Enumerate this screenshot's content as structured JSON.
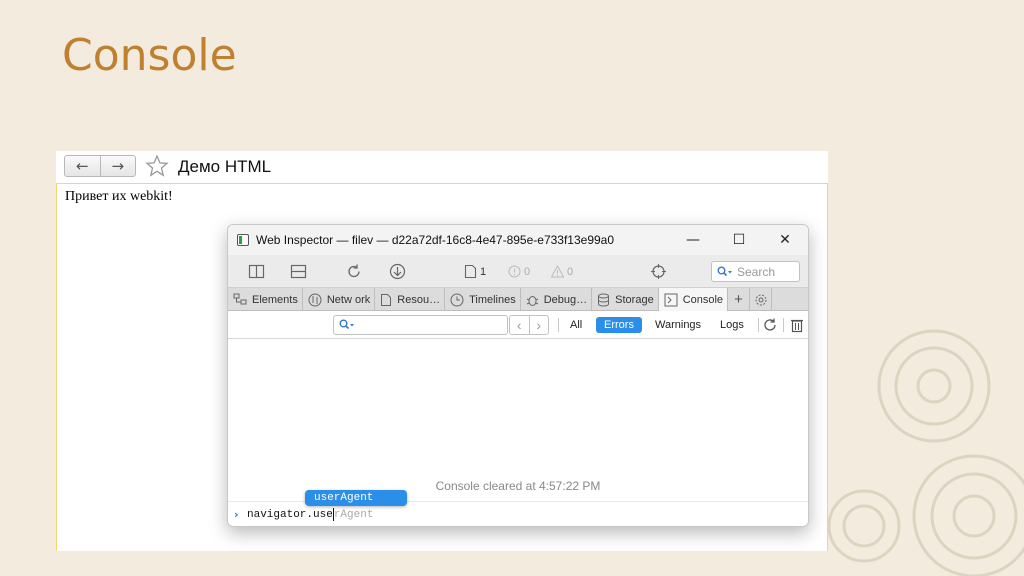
{
  "slide": {
    "title": "Console"
  },
  "browser": {
    "back_label": "←",
    "forward_label": "→",
    "tab_title": "Демо HTML",
    "page_text": "Привет их webkit!"
  },
  "inspector": {
    "window_title": "Web Inspector — filev — d22a72df-16c8-4e47-895e-e733f13e99a0",
    "controls": {
      "minimize": "—",
      "maximize": "☐",
      "close": "✕"
    },
    "toolbar": {
      "resource_count": "1",
      "error_count": "0",
      "warning_count": "0",
      "search_placeholder": "Search"
    },
    "tabs": [
      {
        "label": "Elements",
        "icon": "elements-icon"
      },
      {
        "label": "Netw ork",
        "icon": "network-icon"
      },
      {
        "label": "Resou…",
        "icon": "resources-icon"
      },
      {
        "label": "Timelines",
        "icon": "timelines-icon"
      },
      {
        "label": "Debug…",
        "icon": "debugger-icon"
      },
      {
        "label": "Storage",
        "icon": "storage-icon"
      },
      {
        "label": "Console",
        "icon": "console-icon",
        "active": true
      }
    ],
    "filters": {
      "all": "All",
      "errors": "Errors",
      "warnings": "Warnings",
      "logs": "Logs",
      "active": "Errors"
    },
    "console": {
      "message": "Console cleared at 4:57:22 PM",
      "input_typed": "navigator.use",
      "input_suggestion": "rAgent",
      "autocomplete_item": "userAgent"
    },
    "colors": {
      "accent": "#2b8ee8",
      "title": "#c0802f"
    }
  }
}
